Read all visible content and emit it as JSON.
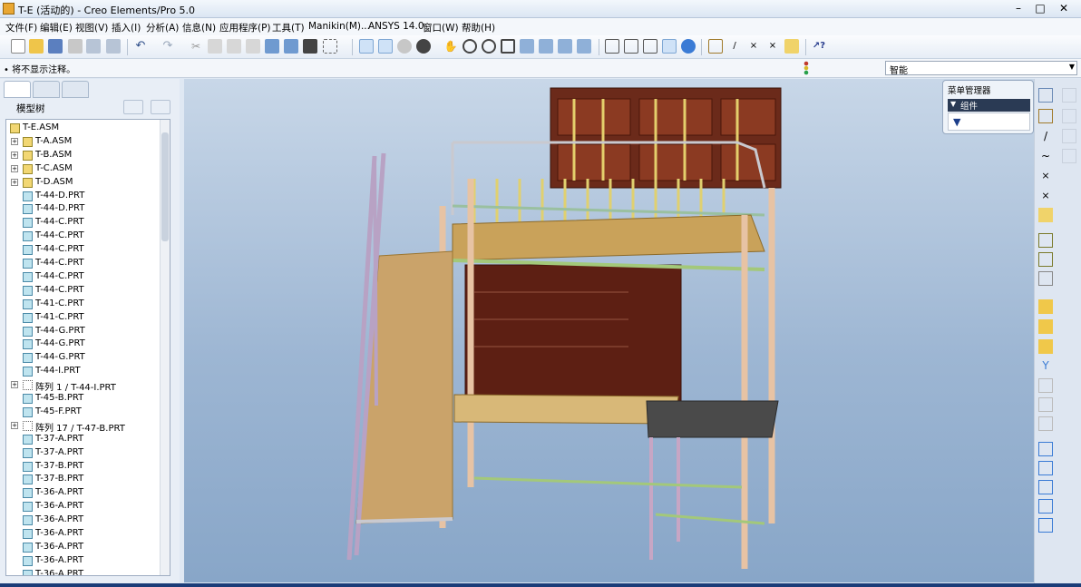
{
  "window": {
    "title": "T-E (活动的) - Creo Elements/Pro 5.0"
  },
  "menubar": [
    "文件(F)",
    "编辑(E)",
    "视图(V)",
    "插入(I)",
    "分析(A)",
    "信息(N)",
    "应用程序(P)",
    "工具(T)",
    "Manikin(M)...",
    "ANSYS 14.0",
    "窗口(W)",
    "帮助(H)"
  ],
  "status": {
    "message": "• 将不显示注释。",
    "filter_value": "智能"
  },
  "panel": {
    "tree_label": "模型树"
  },
  "tree": [
    {
      "label": "T-E.ASM",
      "type": "root",
      "level": 0
    },
    {
      "label": "T-A.ASM",
      "type": "asm",
      "level": 1,
      "expandable": true
    },
    {
      "label": "T-B.ASM",
      "type": "asm",
      "level": 1,
      "expandable": true
    },
    {
      "label": "T-C.ASM",
      "type": "asm",
      "level": 1,
      "expandable": true
    },
    {
      "label": "T-D.ASM",
      "type": "asm",
      "level": 1,
      "expandable": true
    },
    {
      "label": "T-44-D.PRT",
      "type": "prt",
      "level": 1
    },
    {
      "label": "T-44-D.PRT",
      "type": "prt",
      "level": 1
    },
    {
      "label": "T-44-C.PRT",
      "type": "prt",
      "level": 1
    },
    {
      "label": "T-44-C.PRT",
      "type": "prt",
      "level": 1
    },
    {
      "label": "T-44-C.PRT",
      "type": "prt",
      "level": 1
    },
    {
      "label": "T-44-C.PRT",
      "type": "prt",
      "level": 1
    },
    {
      "label": "T-44-C.PRT",
      "type": "prt",
      "level": 1
    },
    {
      "label": "T-44-C.PRT",
      "type": "prt",
      "level": 1
    },
    {
      "label": "T-41-C.PRT",
      "type": "prt",
      "level": 1
    },
    {
      "label": "T-41-C.PRT",
      "type": "prt",
      "level": 1
    },
    {
      "label": "T-44-G.PRT",
      "type": "prt",
      "level": 1
    },
    {
      "label": "T-44-G.PRT",
      "type": "prt",
      "level": 1
    },
    {
      "label": "T-44-G.PRT",
      "type": "prt",
      "level": 1
    },
    {
      "label": "T-44-I.PRT",
      "type": "prt",
      "level": 1
    },
    {
      "label": "阵列 1 / T-44-I.PRT",
      "type": "pattern",
      "level": 1,
      "expandable": true
    },
    {
      "label": "T-45-B.PRT",
      "type": "prt",
      "level": 1
    },
    {
      "label": "T-45-F.PRT",
      "type": "prt",
      "level": 1
    },
    {
      "label": "阵列 17 / T-47-B.PRT",
      "type": "pattern",
      "level": 1,
      "expandable": true
    },
    {
      "label": "T-37-A.PRT",
      "type": "prt",
      "level": 1
    },
    {
      "label": "T-37-A.PRT",
      "type": "prt",
      "level": 1
    },
    {
      "label": "T-37-B.PRT",
      "type": "prt",
      "level": 1
    },
    {
      "label": "T-37-B.PRT",
      "type": "prt",
      "level": 1
    },
    {
      "label": "T-36-A.PRT",
      "type": "prt",
      "level": 1
    },
    {
      "label": "T-36-A.PRT",
      "type": "prt",
      "level": 1
    },
    {
      "label": "T-36-A.PRT",
      "type": "prt",
      "level": 1
    },
    {
      "label": "T-36-A.PRT",
      "type": "prt",
      "level": 1
    },
    {
      "label": "T-36-A.PRT",
      "type": "prt",
      "level": 1
    },
    {
      "label": "T-36-A.PRT",
      "type": "prt",
      "level": 1
    },
    {
      "label": "T-36-A.PRT",
      "type": "prt",
      "level": 1
    }
  ],
  "menu_manager": {
    "title": "菜单管理器",
    "item": "组件",
    "body_glyph": "▼"
  },
  "colors": {
    "viewport_top": "#c8d7e8",
    "viewport_bottom": "#88a6c8",
    "frame_silver": "#c9c9cf",
    "wood": "#6b2a1a",
    "plank": "#c9a25a"
  }
}
